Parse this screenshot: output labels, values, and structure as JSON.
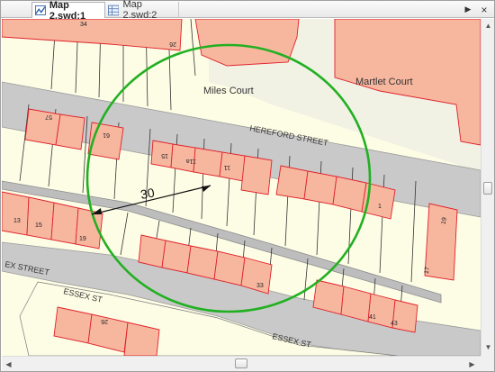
{
  "tabs": [
    {
      "label": "Map 2.swd:1",
      "icon": "map-document-icon",
      "active": true
    },
    {
      "label": "Map 2.swd:2",
      "icon": "table-grid-icon",
      "active": false
    }
  ],
  "map": {
    "places": {
      "martlet_court": "Martlet Court",
      "miles_court": "Miles Court"
    },
    "streets": {
      "hereford_street": "HEREFORD STREET",
      "essex_street_west": "EX STREET",
      "essex_st_mid": "ESSEX ST",
      "essex_st_lower": "ESSEX ST"
    },
    "house_numbers": {
      "n34": "34",
      "n26": "26",
      "n57": "57",
      "n61": "61",
      "n15u": "15",
      "n11a": "11a",
      "n11": "11",
      "n1": "1",
      "n19r": "19",
      "n17": "17",
      "n13": "13",
      "n15": "15",
      "n19": "19",
      "n33": "33",
      "n41": "41",
      "n43": "43",
      "n26b": "26"
    },
    "measurement": {
      "value": "30"
    },
    "colors": {
      "building_fill": "#f7b79f",
      "building_outline": "#e0202a",
      "road": "#c9c9c9",
      "land": "#fdfde6",
      "circle": "#22b022"
    }
  }
}
